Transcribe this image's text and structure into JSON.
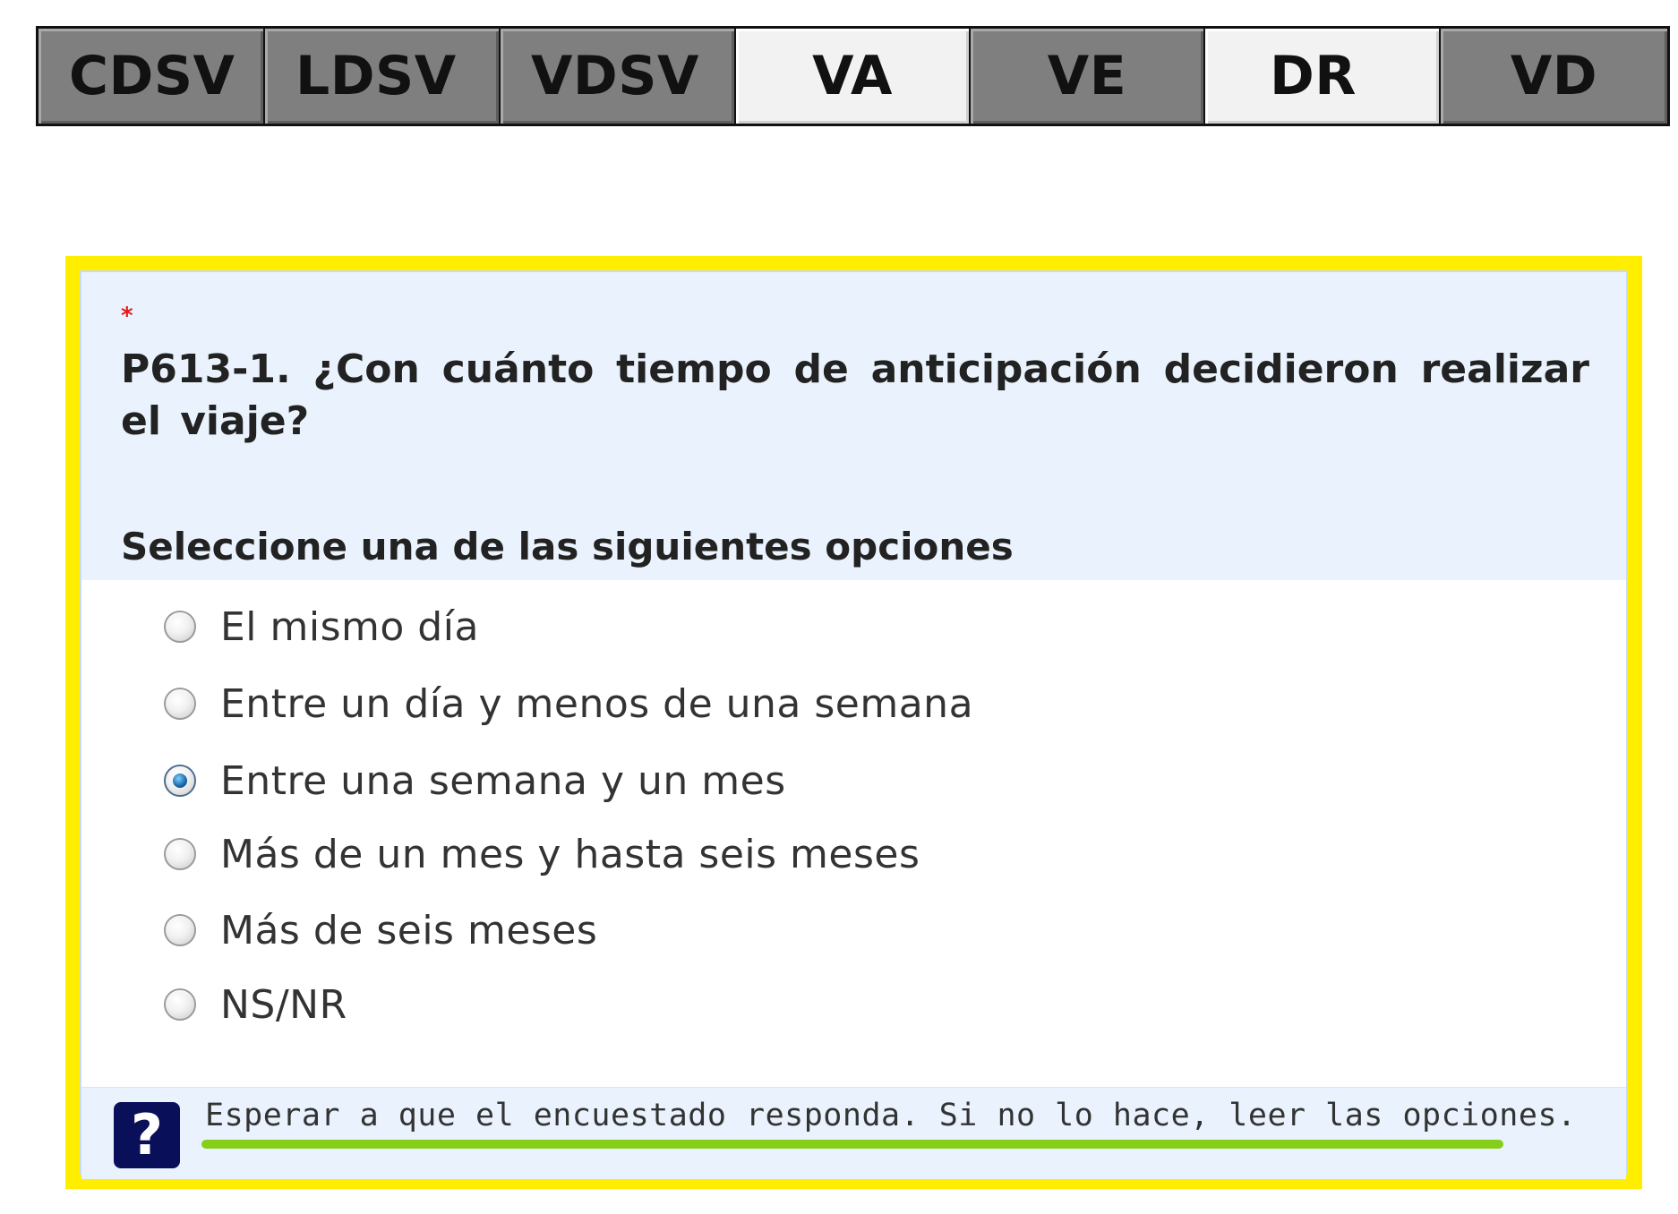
{
  "tabs": [
    {
      "label": "CDSV",
      "state": "inactive"
    },
    {
      "label": "LDSV",
      "state": "inactive"
    },
    {
      "label": "VDSV",
      "state": "inactive"
    },
    {
      "label": "VA",
      "state": "active"
    },
    {
      "label": "VE",
      "state": "inactive"
    },
    {
      "label": "DR",
      "state": "active"
    },
    {
      "label": "VD",
      "state": "inactive"
    }
  ],
  "question": {
    "required_marker": "*",
    "text": "P613-1. ¿Con cuánto tiempo de anticipación decidieron realizar el viaje?",
    "instruction": "Seleccione una de las siguientes opciones"
  },
  "options": [
    {
      "label": "El mismo día",
      "selected": false
    },
    {
      "label": "Entre un día y menos de una semana",
      "selected": false
    },
    {
      "label": "Entre una semana y un mes",
      "selected": true
    },
    {
      "label": "Más de un mes y hasta seis meses",
      "selected": false
    },
    {
      "label": "Más de seis meses",
      "selected": false
    },
    {
      "label": "NS/NR",
      "selected": false
    }
  ],
  "help": {
    "icon_glyph": "?",
    "text": "Esperar a que el encuestado responda. Si no lo hace, leer las opciones."
  },
  "colors": {
    "highlight_border": "#ffee00",
    "tab_inactive": "#7f7f7f",
    "tab_active": "#f2f2f2",
    "question_background": "#eaf3fd",
    "help_icon": "#0a0f5a",
    "help_underline": "#86cf18",
    "required_marker": "#e01b1b"
  }
}
